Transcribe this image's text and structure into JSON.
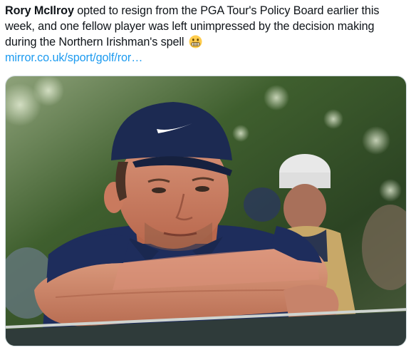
{
  "tweet": {
    "author_mention": "Rory McIlroy",
    "text_part1": " opted to resign from the PGA Tour's Policy Board earlier this week, and one fellow player was left unimpressed by the decision making during the Northern Irishman's spell ",
    "emoji": "grimacing-face-icon",
    "link_text": "mirror.co.uk/sport/golf/ror…"
  },
  "media": {
    "kind": "photo",
    "icon": "golfer-photo"
  },
  "colors": {
    "text": "#0f1419",
    "link": "#1d9bf0",
    "border": "#cfd9de",
    "cap": "#1c2a52",
    "shirt": "#1e2d5c",
    "background_green": "#3a5a2a"
  }
}
